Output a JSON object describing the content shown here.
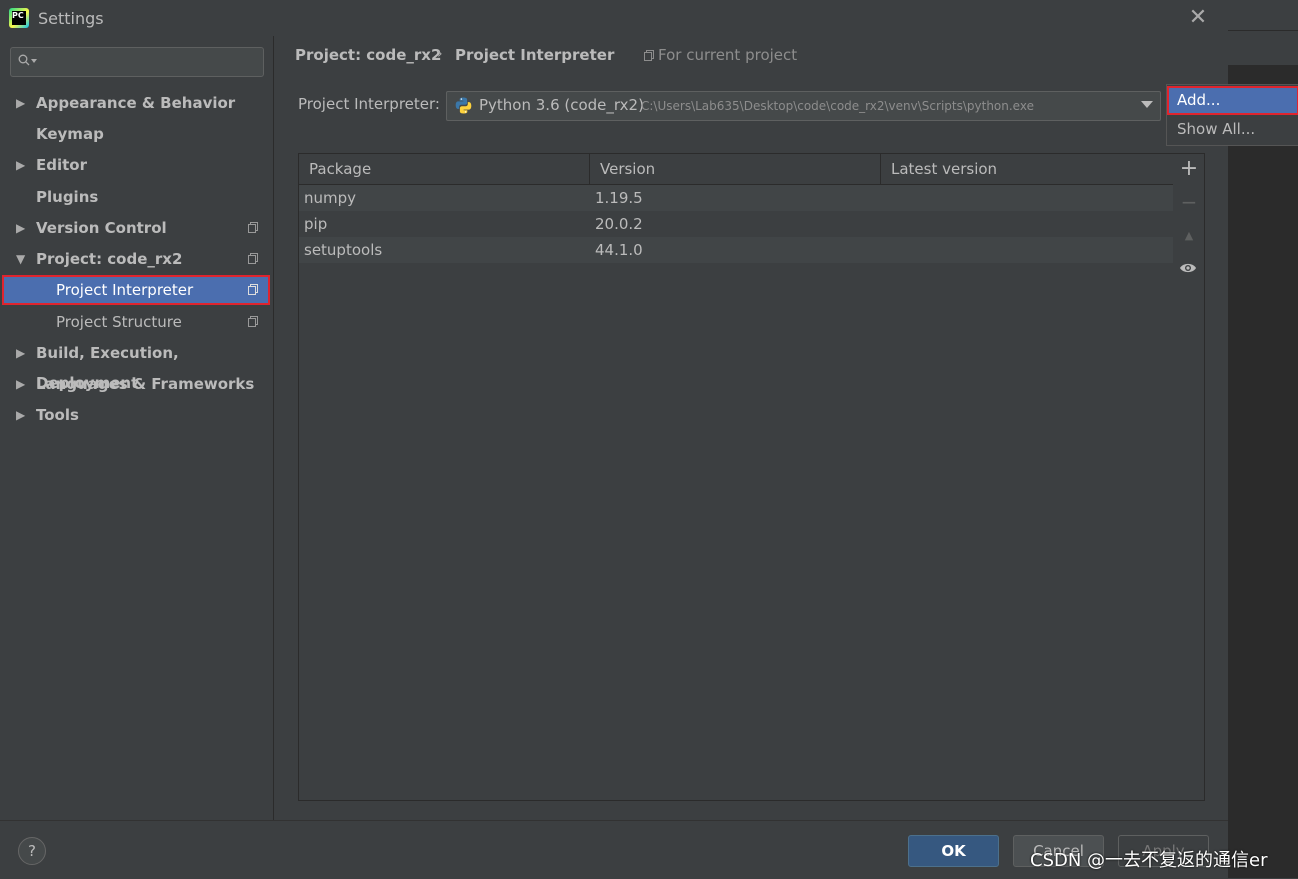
{
  "window": {
    "title": "Settings",
    "app_icon_text": "PC"
  },
  "search": {
    "placeholder": ""
  },
  "sidebar": {
    "items": [
      {
        "label": "Appearance & Behavior",
        "expandable": true,
        "expanded": false
      },
      {
        "label": "Keymap",
        "expandable": false
      },
      {
        "label": "Editor",
        "expandable": true,
        "expanded": false
      },
      {
        "label": "Plugins",
        "expandable": false
      },
      {
        "label": "Version Control",
        "expandable": true,
        "expanded": false
      },
      {
        "label": "Project: code_rx2",
        "expandable": true,
        "expanded": true
      },
      {
        "label": "Project Interpreter",
        "child": true,
        "selected": true
      },
      {
        "label": "Project Structure",
        "child": true
      },
      {
        "label": "Build, Execution, Deployment",
        "expandable": true,
        "expanded": false
      },
      {
        "label": "Languages & Frameworks",
        "expandable": true,
        "expanded": false
      },
      {
        "label": "Tools",
        "expandable": true,
        "expanded": false
      }
    ]
  },
  "breadcrumb": {
    "project": "Project: code_rx2",
    "separator": "›",
    "page": "Project Interpreter",
    "scope": "For current project"
  },
  "interpreter": {
    "label": "Project Interpreter:",
    "name": "Python 3.6 (code_rx2)",
    "path": "C:\\Users\\Lab635\\Desktop\\code\\code_rx2\\venv\\Scripts\\python.exe"
  },
  "packages": {
    "headers": [
      "Package",
      "Version",
      "Latest version"
    ],
    "rows": [
      {
        "package": "numpy",
        "version": "1.19.5",
        "latest": ""
      },
      {
        "package": "pip",
        "version": "20.0.2",
        "latest": ""
      },
      {
        "package": "setuptools",
        "version": "44.1.0",
        "latest": ""
      }
    ]
  },
  "toolbar": {
    "add": "+",
    "remove": "−",
    "upgrade": "▲"
  },
  "popup": {
    "add_label": "Add...",
    "show_all_label": "Show All..."
  },
  "buttons": {
    "help": "?",
    "ok": "OK",
    "cancel": "Cancel",
    "apply": "Apply"
  },
  "watermark": "CSDN @一去不复返的通信er",
  "colors": {
    "selection": "#4b6eaf",
    "highlight_border": "#e0242e",
    "ok_button": "#365880"
  }
}
